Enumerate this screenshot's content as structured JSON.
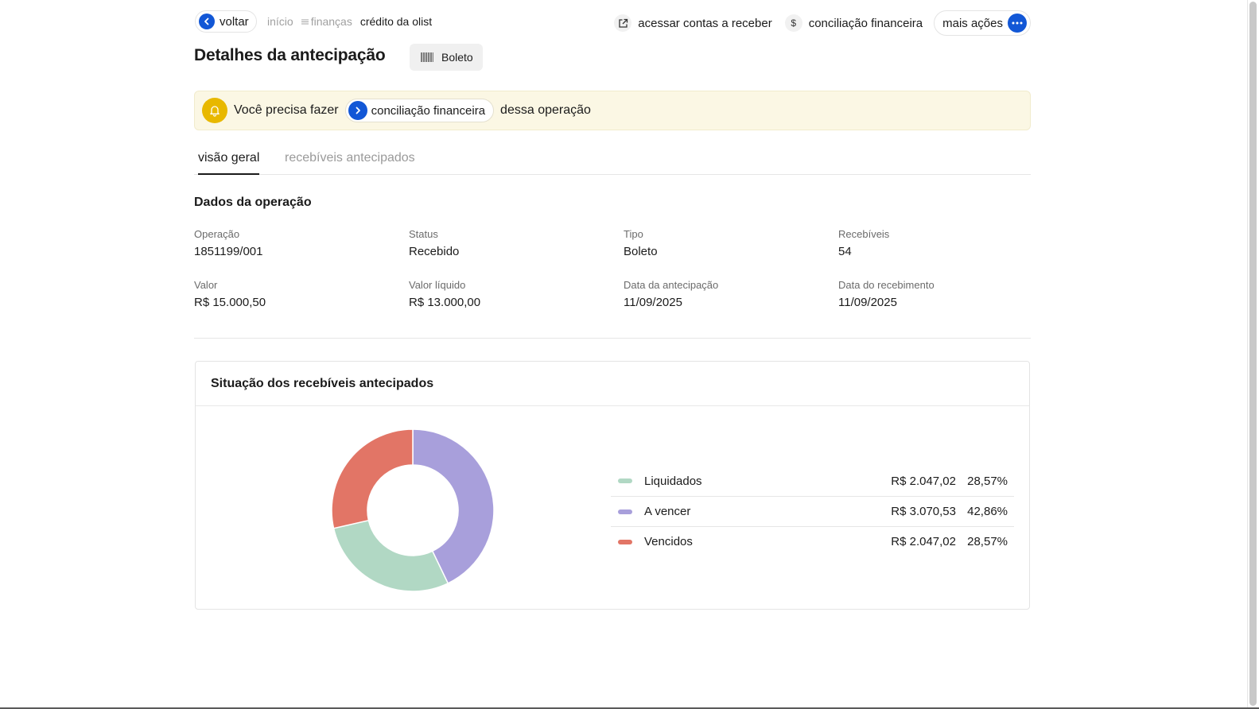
{
  "nav": {
    "back_label": "voltar",
    "breadcrumb": [
      "início",
      "finanças",
      "crédito da olist"
    ]
  },
  "actions": {
    "receivables": "acessar contas a receber",
    "reconciliation": "conciliação financeira",
    "more": "mais ações"
  },
  "page": {
    "title": "Detalhes da antecipação",
    "tag": "Boleto"
  },
  "alert": {
    "before": "Você precisa fazer",
    "link": "conciliação financeira",
    "after": "dessa operação"
  },
  "tabs": [
    "visão geral",
    "recebíveis antecipados"
  ],
  "operation": {
    "section_title": "Dados da operação",
    "fields": [
      {
        "label": "Operação",
        "value": "1851199/001"
      },
      {
        "label": "Status",
        "value": "Recebido"
      },
      {
        "label": "Tipo",
        "value": "Boleto"
      },
      {
        "label": "Recebíveis",
        "value": "54"
      },
      {
        "label": "Valor",
        "value": "R$ 15.000,50"
      },
      {
        "label": "Valor líquido",
        "value": "R$ 13.000,00"
      },
      {
        "label": "Data da antecipação",
        "value": "11/09/2025"
      },
      {
        "label": "Data do recebimento",
        "value": "11/09/2025"
      }
    ]
  },
  "receivables_card": {
    "title": "Situação dos recebíveis antecipados"
  },
  "chart_data": {
    "type": "pie",
    "categories": [
      "Liquidados",
      "A vencer",
      "Vencidos"
    ],
    "values": [
      2047.02,
      3070.53,
      2047.02
    ],
    "amounts": [
      "R$ 2.047,02",
      "R$ 3.070,53",
      "R$ 2.047,02"
    ],
    "percentages": [
      "28,57%",
      "42,86%",
      "28,57%"
    ],
    "colors": [
      "#b1d8c4",
      "#a89fdb",
      "#e27566"
    ],
    "legend": "right"
  },
  "colors": {
    "accent": "#1257d6",
    "alert_bg": "#fbf7e4",
    "bell": "#e8b800"
  }
}
